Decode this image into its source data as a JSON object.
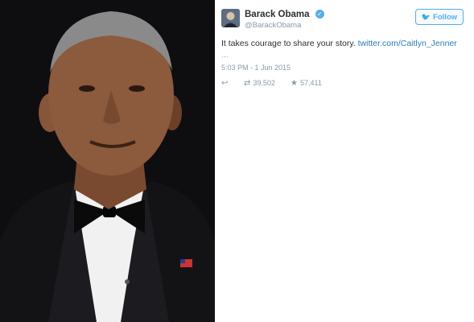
{
  "tweet": {
    "display_name": "Barack Obama",
    "handle": "@BarackObama",
    "follow_label": "Follow",
    "text": "It takes courage to share your story.",
    "link": "twitter.com/Caitlyn_Jenner",
    "ellipsis": "…",
    "timestamp": "5:03 PM - 1 Jun 2015",
    "retweets": "39,502",
    "likes": "57,411"
  },
  "colors": {
    "accent": "#55acee",
    "link": "#2b7bb9",
    "muted": "#8899a6",
    "text": "#292f33"
  },
  "icons": [
    "verified-icon",
    "bird-icon",
    "reply-icon",
    "retweet-icon",
    "star-icon"
  ]
}
